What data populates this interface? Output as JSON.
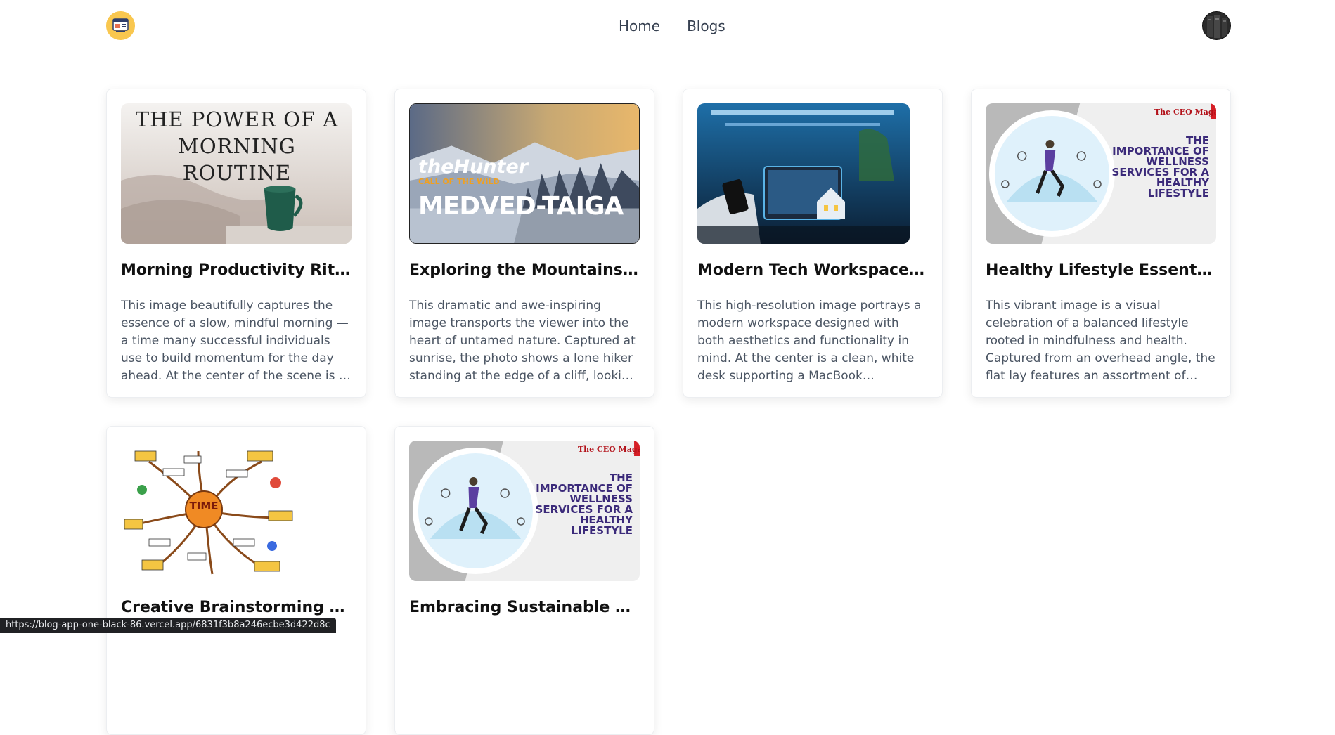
{
  "nav": {
    "links": [
      "Home",
      "Blogs"
    ]
  },
  "cards": [
    {
      "title": "Morning Productivity Rituals",
      "image_text": [
        "THE POWER OF A",
        "MORNING ROUTINE"
      ],
      "desc": "This image beautifully captures the essence of a slow, mindful morning — a time many successful individuals use to build momentum for the day ahead. At the center of the scene is a steaming cup..."
    },
    {
      "title": "Exploring the Mountains – Th...",
      "image_text": [
        "theHunter",
        "CALL OF THE WILD",
        "MEDVED-TAIGA"
      ],
      "desc": "This dramatic and awe-inspiring image transports the viewer into the heart of untamed nature. Captured at sunrise, the photo shows a lone hiker standing at the edge of a cliff, looking out over endless..."
    },
    {
      "title": "Modern Tech Workspace: A...",
      "image_text": [],
      "desc": "This high-resolution image portrays a modern workspace designed with both aesthetics and functionality in mind. At the center is a clean, white desk supporting a MacBook connected to an..."
    },
    {
      "title": "Healthy Lifestyle Essentials:...",
      "image_text": [
        "The CEO Magazine",
        "THE",
        "IMPORTANCE OF",
        "WELLNESS",
        "SERVICES FOR A",
        "HEALTHY",
        "LIFESTYLE"
      ],
      "desc": "This vibrant image is a visual celebration of a balanced lifestyle rooted in mindfulness and health. Captured from an overhead angle, the flat lay features an assortment of health and wellness..."
    },
    {
      "title": "Creative Brainstorming Sessio...",
      "image_text": [
        "TIME"
      ],
      "desc": ""
    },
    {
      "title": "Embracing Sustainable Living:...",
      "image_text": [
        "The CEO Magazine",
        "THE",
        "IMPORTANCE OF",
        "WELLNESS",
        "SERVICES FOR A",
        "HEALTHY",
        "LIFESTYLE"
      ],
      "desc": ""
    }
  ],
  "status_url": "https://blog-app-one-black-86.vercel.app/6831f3b8a246ecbe3d422d8c"
}
